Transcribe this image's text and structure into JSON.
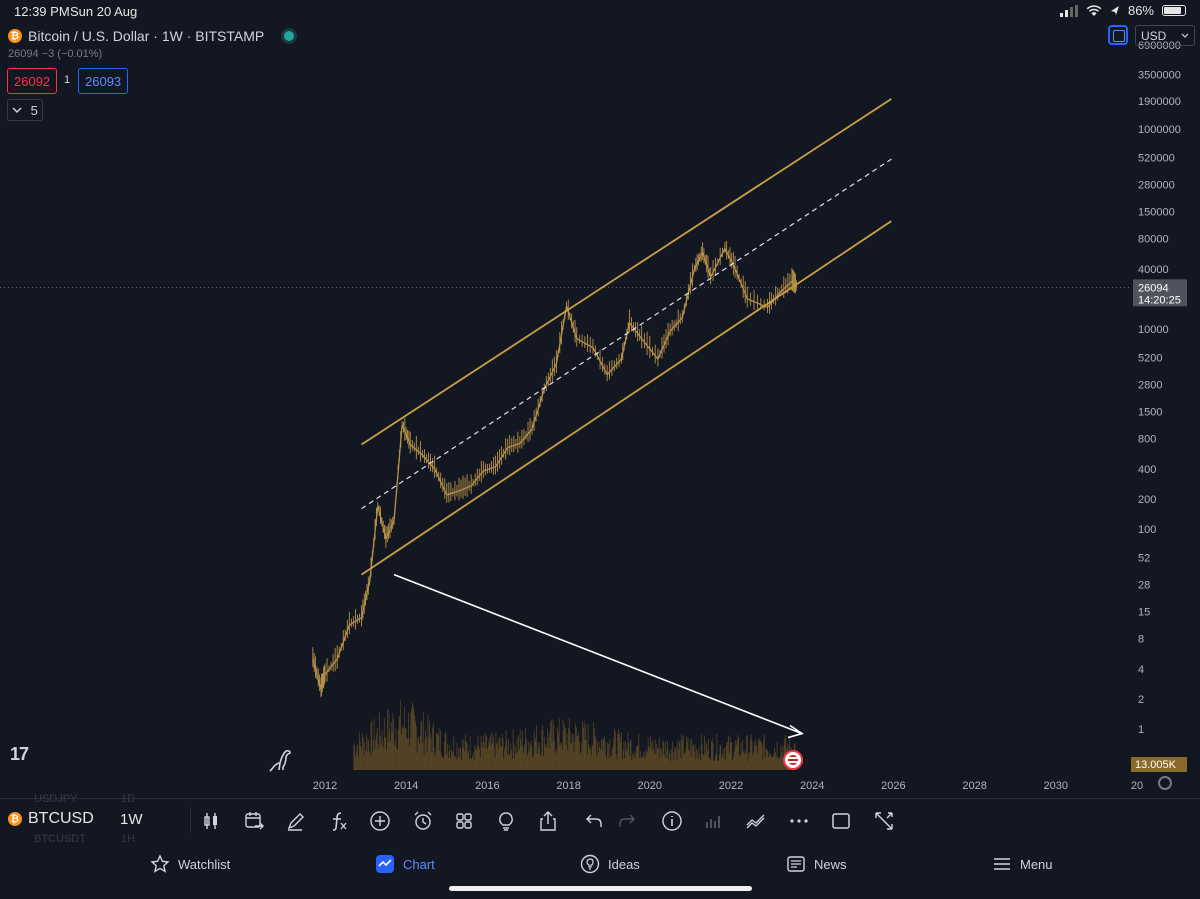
{
  "status_bar": {
    "time": "12:39 PM",
    "date": "Sun 20 Aug",
    "battery": "86%",
    "battery_level": 0.86
  },
  "header": {
    "symbol_title": "Bitcoin / U.S. Dollar · 1W · BITSTAMP",
    "price_change": "26094 −3 (−0.01%)",
    "sell_price": "26092",
    "spread": "1",
    "buy_price": "26093",
    "indicator_count": "5",
    "currency": "USD"
  },
  "chart_data": {
    "type": "candlestick",
    "x_ticks": [
      "2012",
      "2014",
      "2016",
      "2018",
      "2020",
      "2022",
      "2024",
      "2026",
      "2028",
      "2030",
      "20"
    ],
    "y_ticks": [
      "6900000",
      "3500000",
      "1900000",
      "1000000",
      "520000",
      "280000",
      "150000",
      "80000",
      "40000",
      "10000",
      "5200",
      "2800",
      "1500",
      "800",
      "400",
      "200",
      "100",
      "52",
      "28",
      "15",
      "8",
      "4",
      "2",
      "1"
    ],
    "y_scale": "log",
    "last_price_label": "26094",
    "countdown_label": "14:20:25",
    "volume_label": "13.005K",
    "price_path": [
      [
        2011.7,
        5
      ],
      [
        2011.9,
        2.5
      ],
      [
        2012.0,
        3.5
      ],
      [
        2012.3,
        5
      ],
      [
        2012.6,
        11
      ],
      [
        2012.9,
        13
      ],
      [
        2013.1,
        30
      ],
      [
        2013.3,
        170
      ],
      [
        2013.5,
        80
      ],
      [
        2013.7,
        120
      ],
      [
        2013.9,
        1100
      ],
      [
        2014.1,
        700
      ],
      [
        2014.4,
        550
      ],
      [
        2014.7,
        400
      ],
      [
        2015.0,
        220
      ],
      [
        2015.3,
        240
      ],
      [
        2015.6,
        270
      ],
      [
        2015.9,
        380
      ],
      [
        2016.2,
        420
      ],
      [
        2016.5,
        650
      ],
      [
        2016.8,
        720
      ],
      [
        2017.1,
        1000
      ],
      [
        2017.4,
        2500
      ],
      [
        2017.7,
        4500
      ],
      [
        2017.95,
        17000
      ],
      [
        2018.2,
        8000
      ],
      [
        2018.6,
        6500
      ],
      [
        2018.95,
        3500
      ],
      [
        2019.3,
        5000
      ],
      [
        2019.5,
        11500
      ],
      [
        2019.8,
        8000
      ],
      [
        2020.2,
        5000
      ],
      [
        2020.5,
        9500
      ],
      [
        2020.8,
        13000
      ],
      [
        2021.1,
        40000
      ],
      [
        2021.3,
        58000
      ],
      [
        2021.5,
        33000
      ],
      [
        2021.85,
        64000
      ],
      [
        2022.1,
        40000
      ],
      [
        2022.4,
        20000
      ],
      [
        2022.9,
        16500
      ],
      [
        2023.2,
        23000
      ],
      [
        2023.5,
        30000
      ],
      [
        2023.63,
        26094
      ]
    ],
    "annotations": [
      "upper-channel-line",
      "midline-dashed",
      "lower-channel-line",
      "arrow"
    ],
    "channel_color": "#c9a043",
    "candle_color": "#b89248",
    "volume_color": "#8a6a28"
  },
  "toolbar": {
    "ghost_top": "USDJPY",
    "ghost_top_interval": "1D",
    "symbol": "BTCUSD",
    "interval": "1W",
    "ghost_bottom": "BTCUSDT",
    "ghost_bottom_interval": "1H"
  },
  "tabs": [
    {
      "label": "Watchlist",
      "icon": "star-icon"
    },
    {
      "label": "Chart",
      "icon": "chart-icon"
    },
    {
      "label": "Ideas",
      "icon": "bulb-icon"
    },
    {
      "label": "News",
      "icon": "news-icon"
    },
    {
      "label": "Menu",
      "icon": "menu-icon"
    }
  ],
  "colors": {
    "background": "#131722",
    "accent": "#2962ff",
    "sell": "#f23645",
    "live": "#26a69a"
  }
}
